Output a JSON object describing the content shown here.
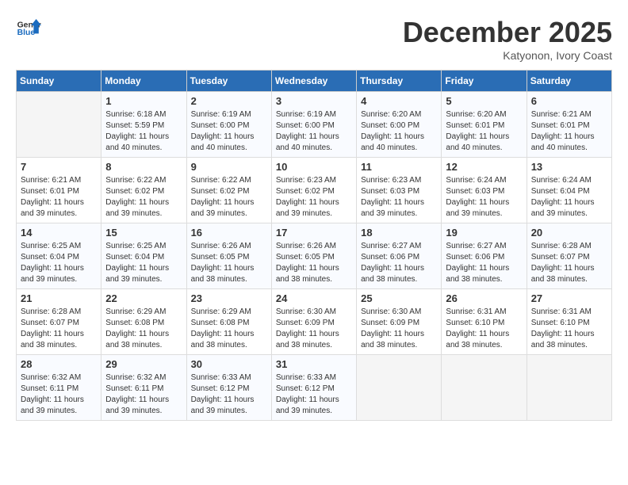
{
  "header": {
    "logo_line1": "General",
    "logo_line2": "Blue",
    "month": "December 2025",
    "location": "Katyonon, Ivory Coast"
  },
  "days_of_week": [
    "Sunday",
    "Monday",
    "Tuesday",
    "Wednesday",
    "Thursday",
    "Friday",
    "Saturday"
  ],
  "weeks": [
    [
      {
        "day": null
      },
      {
        "day": 1,
        "sunrise": "6:18 AM",
        "sunset": "5:59 PM",
        "daylight": "11 hours and 40 minutes."
      },
      {
        "day": 2,
        "sunrise": "6:19 AM",
        "sunset": "6:00 PM",
        "daylight": "11 hours and 40 minutes."
      },
      {
        "day": 3,
        "sunrise": "6:19 AM",
        "sunset": "6:00 PM",
        "daylight": "11 hours and 40 minutes."
      },
      {
        "day": 4,
        "sunrise": "6:20 AM",
        "sunset": "6:00 PM",
        "daylight": "11 hours and 40 minutes."
      },
      {
        "day": 5,
        "sunrise": "6:20 AM",
        "sunset": "6:01 PM",
        "daylight": "11 hours and 40 minutes."
      },
      {
        "day": 6,
        "sunrise": "6:21 AM",
        "sunset": "6:01 PM",
        "daylight": "11 hours and 40 minutes."
      }
    ],
    [
      {
        "day": 7,
        "sunrise": "6:21 AM",
        "sunset": "6:01 PM",
        "daylight": "11 hours and 39 minutes."
      },
      {
        "day": 8,
        "sunrise": "6:22 AM",
        "sunset": "6:02 PM",
        "daylight": "11 hours and 39 minutes."
      },
      {
        "day": 9,
        "sunrise": "6:22 AM",
        "sunset": "6:02 PM",
        "daylight": "11 hours and 39 minutes."
      },
      {
        "day": 10,
        "sunrise": "6:23 AM",
        "sunset": "6:02 PM",
        "daylight": "11 hours and 39 minutes."
      },
      {
        "day": 11,
        "sunrise": "6:23 AM",
        "sunset": "6:03 PM",
        "daylight": "11 hours and 39 minutes."
      },
      {
        "day": 12,
        "sunrise": "6:24 AM",
        "sunset": "6:03 PM",
        "daylight": "11 hours and 39 minutes."
      },
      {
        "day": 13,
        "sunrise": "6:24 AM",
        "sunset": "6:04 PM",
        "daylight": "11 hours and 39 minutes."
      }
    ],
    [
      {
        "day": 14,
        "sunrise": "6:25 AM",
        "sunset": "6:04 PM",
        "daylight": "11 hours and 39 minutes."
      },
      {
        "day": 15,
        "sunrise": "6:25 AM",
        "sunset": "6:04 PM",
        "daylight": "11 hours and 39 minutes."
      },
      {
        "day": 16,
        "sunrise": "6:26 AM",
        "sunset": "6:05 PM",
        "daylight": "11 hours and 38 minutes."
      },
      {
        "day": 17,
        "sunrise": "6:26 AM",
        "sunset": "6:05 PM",
        "daylight": "11 hours and 38 minutes."
      },
      {
        "day": 18,
        "sunrise": "6:27 AM",
        "sunset": "6:06 PM",
        "daylight": "11 hours and 38 minutes."
      },
      {
        "day": 19,
        "sunrise": "6:27 AM",
        "sunset": "6:06 PM",
        "daylight": "11 hours and 38 minutes."
      },
      {
        "day": 20,
        "sunrise": "6:28 AM",
        "sunset": "6:07 PM",
        "daylight": "11 hours and 38 minutes."
      }
    ],
    [
      {
        "day": 21,
        "sunrise": "6:28 AM",
        "sunset": "6:07 PM",
        "daylight": "11 hours and 38 minutes."
      },
      {
        "day": 22,
        "sunrise": "6:29 AM",
        "sunset": "6:08 PM",
        "daylight": "11 hours and 38 minutes."
      },
      {
        "day": 23,
        "sunrise": "6:29 AM",
        "sunset": "6:08 PM",
        "daylight": "11 hours and 38 minutes."
      },
      {
        "day": 24,
        "sunrise": "6:30 AM",
        "sunset": "6:09 PM",
        "daylight": "11 hours and 38 minutes."
      },
      {
        "day": 25,
        "sunrise": "6:30 AM",
        "sunset": "6:09 PM",
        "daylight": "11 hours and 38 minutes."
      },
      {
        "day": 26,
        "sunrise": "6:31 AM",
        "sunset": "6:10 PM",
        "daylight": "11 hours and 38 minutes."
      },
      {
        "day": 27,
        "sunrise": "6:31 AM",
        "sunset": "6:10 PM",
        "daylight": "11 hours and 38 minutes."
      }
    ],
    [
      {
        "day": 28,
        "sunrise": "6:32 AM",
        "sunset": "6:11 PM",
        "daylight": "11 hours and 39 minutes."
      },
      {
        "day": 29,
        "sunrise": "6:32 AM",
        "sunset": "6:11 PM",
        "daylight": "11 hours and 39 minutes."
      },
      {
        "day": 30,
        "sunrise": "6:33 AM",
        "sunset": "6:12 PM",
        "daylight": "11 hours and 39 minutes."
      },
      {
        "day": 31,
        "sunrise": "6:33 AM",
        "sunset": "6:12 PM",
        "daylight": "11 hours and 39 minutes."
      },
      {
        "day": null
      },
      {
        "day": null
      },
      {
        "day": null
      }
    ]
  ],
  "labels": {
    "sunrise": "Sunrise:",
    "sunset": "Sunset:",
    "daylight": "Daylight:"
  }
}
